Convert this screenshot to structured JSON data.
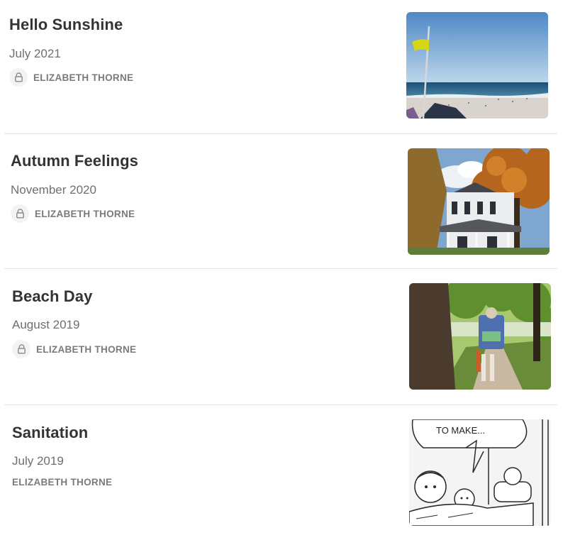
{
  "posts": [
    {
      "title": "Hello Sunshine",
      "date": "July 2021",
      "author": "ELIZABETH THORNE",
      "private": true,
      "image": "beach-with-yellow-flag"
    },
    {
      "title": "Autumn Feelings",
      "date": "November 2020",
      "author": "ELIZABETH THORNE",
      "private": true,
      "image": "house-with-autumn-tree"
    },
    {
      "title": "Beach Day",
      "date": "August 2019",
      "author": "ELIZABETH THORNE",
      "private": true,
      "image": "person-walking-on-sidewalk"
    },
    {
      "title": "Sanitation",
      "date": "July 2019",
      "author": "ELIZABETH THORNE",
      "private": false,
      "image": "comic-strip-panel",
      "image_caption": "TO MAKE..."
    }
  ]
}
